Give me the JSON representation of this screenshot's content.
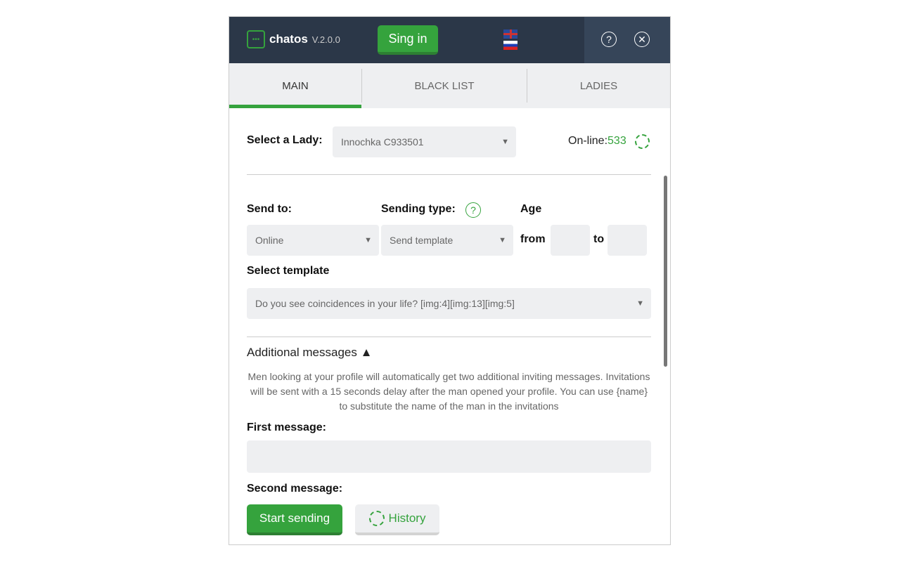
{
  "header": {
    "app_name": "chatos",
    "version": "V.2.0.0",
    "signin_label": "Sing in",
    "languages": [
      "English",
      "Russian"
    ],
    "help_icon": "?",
    "close_icon": "✕"
  },
  "tabs": [
    {
      "label": "MAIN",
      "active": true
    },
    {
      "label": "BLACK LIST"
    },
    {
      "label": "LADIES"
    }
  ],
  "lady": {
    "label": "Select a Lady:",
    "value": "Innochka C933501",
    "online_label": "On-line:",
    "online_count": "533"
  },
  "send_to": {
    "label": "Send to:",
    "value": "Online"
  },
  "sending_type": {
    "label": "Sending type:",
    "value": "Send template"
  },
  "age": {
    "label": "Age",
    "from_label": "from",
    "to_label": "to",
    "from_value": "",
    "to_value": ""
  },
  "template": {
    "label": "Select template",
    "value": "Do you see coincidences in your life? [img:4][img:13][img:5]"
  },
  "additional": {
    "label": "Additional messages",
    "description": "Men looking at your profile will automatically get two additional inviting messages. Invitations will be sent with a 15 seconds delay after the man opened your profile. You can use {name} to substitute the name of the man in the invitations",
    "first_label": "First message:",
    "first_value": "",
    "second_label": "Second message:"
  },
  "buttons": {
    "start": "Start sending",
    "history": "History"
  },
  "colors": {
    "accent": "#35a33d",
    "header": "#2b3748"
  }
}
